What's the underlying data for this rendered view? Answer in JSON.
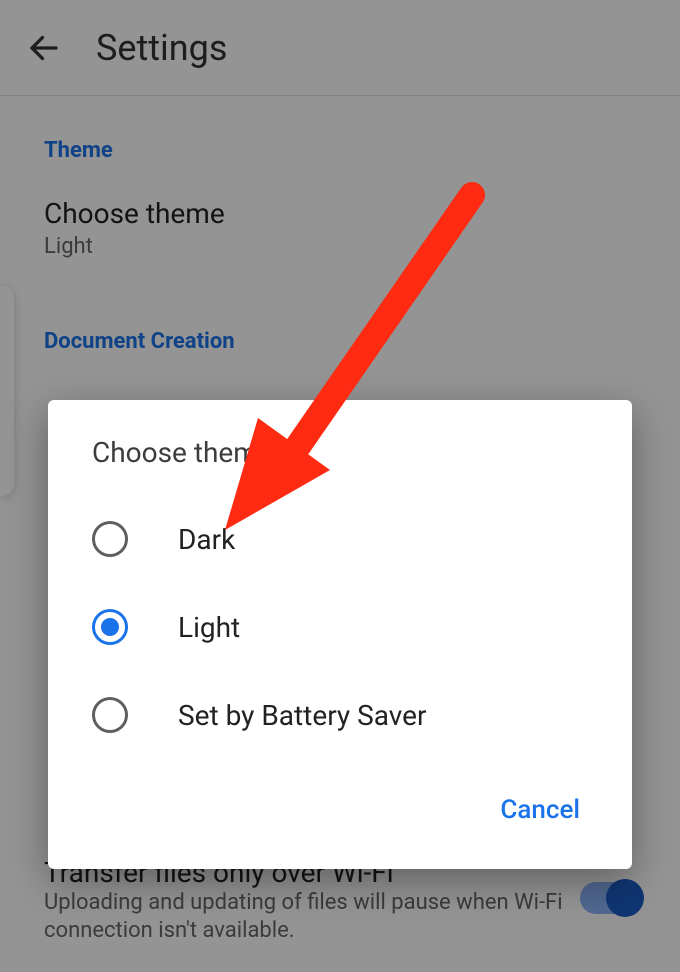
{
  "appbar": {
    "title": "Settings"
  },
  "sections": {
    "theme": {
      "label": "Theme",
      "row_title": "Choose theme",
      "row_value": "Light"
    },
    "doc_creation": {
      "label": "Document Creation"
    },
    "wifi": {
      "title": "Transfer files only over Wi-Fi",
      "subtitle": "Uploading and updating of files will pause when Wi-Fi connection isn't available.",
      "switch_on": true
    }
  },
  "dialog": {
    "title": "Choose theme",
    "options": [
      {
        "label": "Dark",
        "selected": false
      },
      {
        "label": "Light",
        "selected": true
      },
      {
        "label": "Set by Battery Saver",
        "selected": false
      }
    ],
    "cancel": "Cancel"
  },
  "annotation": {
    "arrow_color": "#ff2a12"
  }
}
